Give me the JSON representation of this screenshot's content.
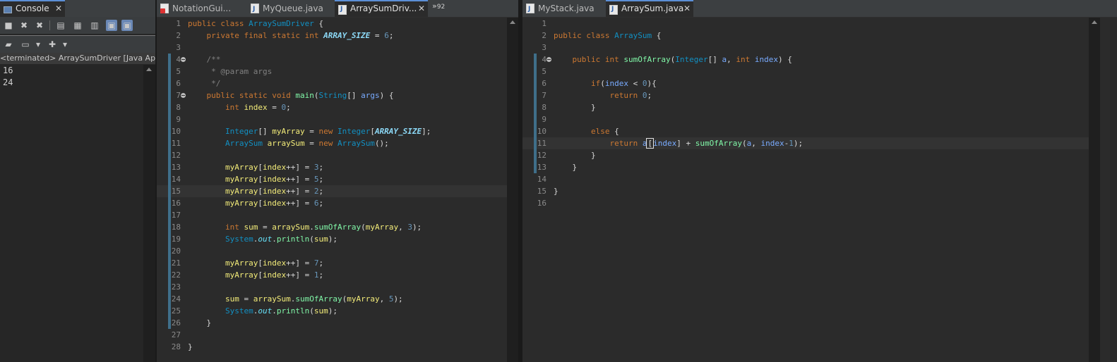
{
  "console": {
    "tab_label": "Console",
    "status_text": "<terminated> ArraySumDriver [Java Appli",
    "output_lines": [
      "16",
      "24"
    ]
  },
  "left_editor": {
    "tabs": [
      {
        "label": "NotationGui..."
      },
      {
        "label": "MyQueue.java"
      },
      {
        "label": "ArraySumDriv..."
      }
    ],
    "overflow_label": "92"
  },
  "right_editor": {
    "tabs": [
      {
        "label": "MyStack.java"
      },
      {
        "label": "ArraySum.java"
      }
    ]
  }
}
